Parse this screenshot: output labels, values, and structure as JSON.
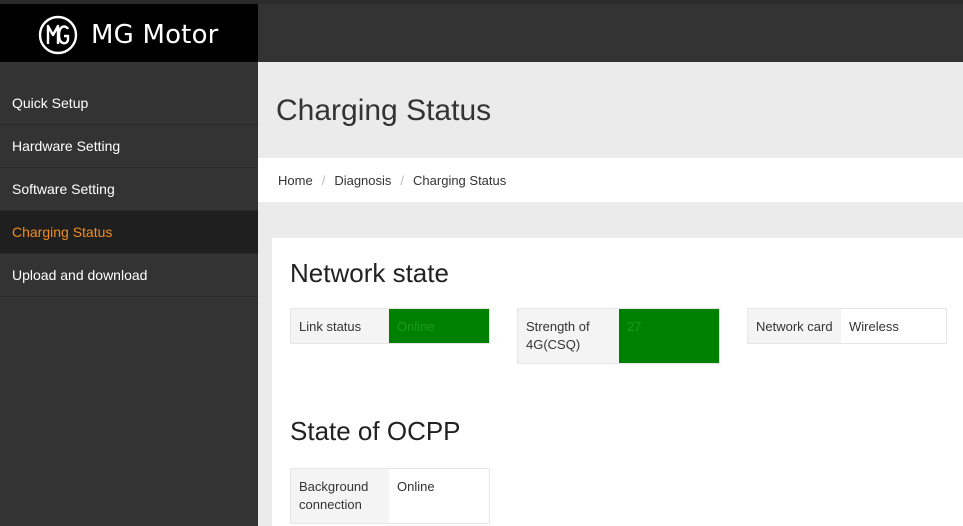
{
  "brand": {
    "name": "MG Motor",
    "logo_icon": "mg-logo-icon"
  },
  "sidebar": {
    "items": [
      {
        "label": "Quick Setup",
        "active": false
      },
      {
        "label": "Hardware Setting",
        "active": false
      },
      {
        "label": "Software Setting",
        "active": false
      },
      {
        "label": "Charging Status",
        "active": true
      },
      {
        "label": "Upload and download",
        "active": false
      }
    ]
  },
  "header": {
    "title": "Charging Status"
  },
  "breadcrumb": {
    "items": [
      "Home",
      "Diagnosis",
      "Charging Status"
    ]
  },
  "network_state": {
    "title": "Network state",
    "link_status": {
      "label": "Link status",
      "value": "Online"
    },
    "signal_strength": {
      "label": "Strength of 4G(CSQ)",
      "value": "27"
    },
    "network_card": {
      "label": "Network card",
      "value": "Wireless"
    }
  },
  "ocpp_state": {
    "title": "State of OCPP",
    "background_connection": {
      "label": "Background connection",
      "value": "Online"
    }
  },
  "colors": {
    "active_nav": "#f38b1c",
    "status_ok_bg": "#008000",
    "header_bg": "#333333"
  }
}
